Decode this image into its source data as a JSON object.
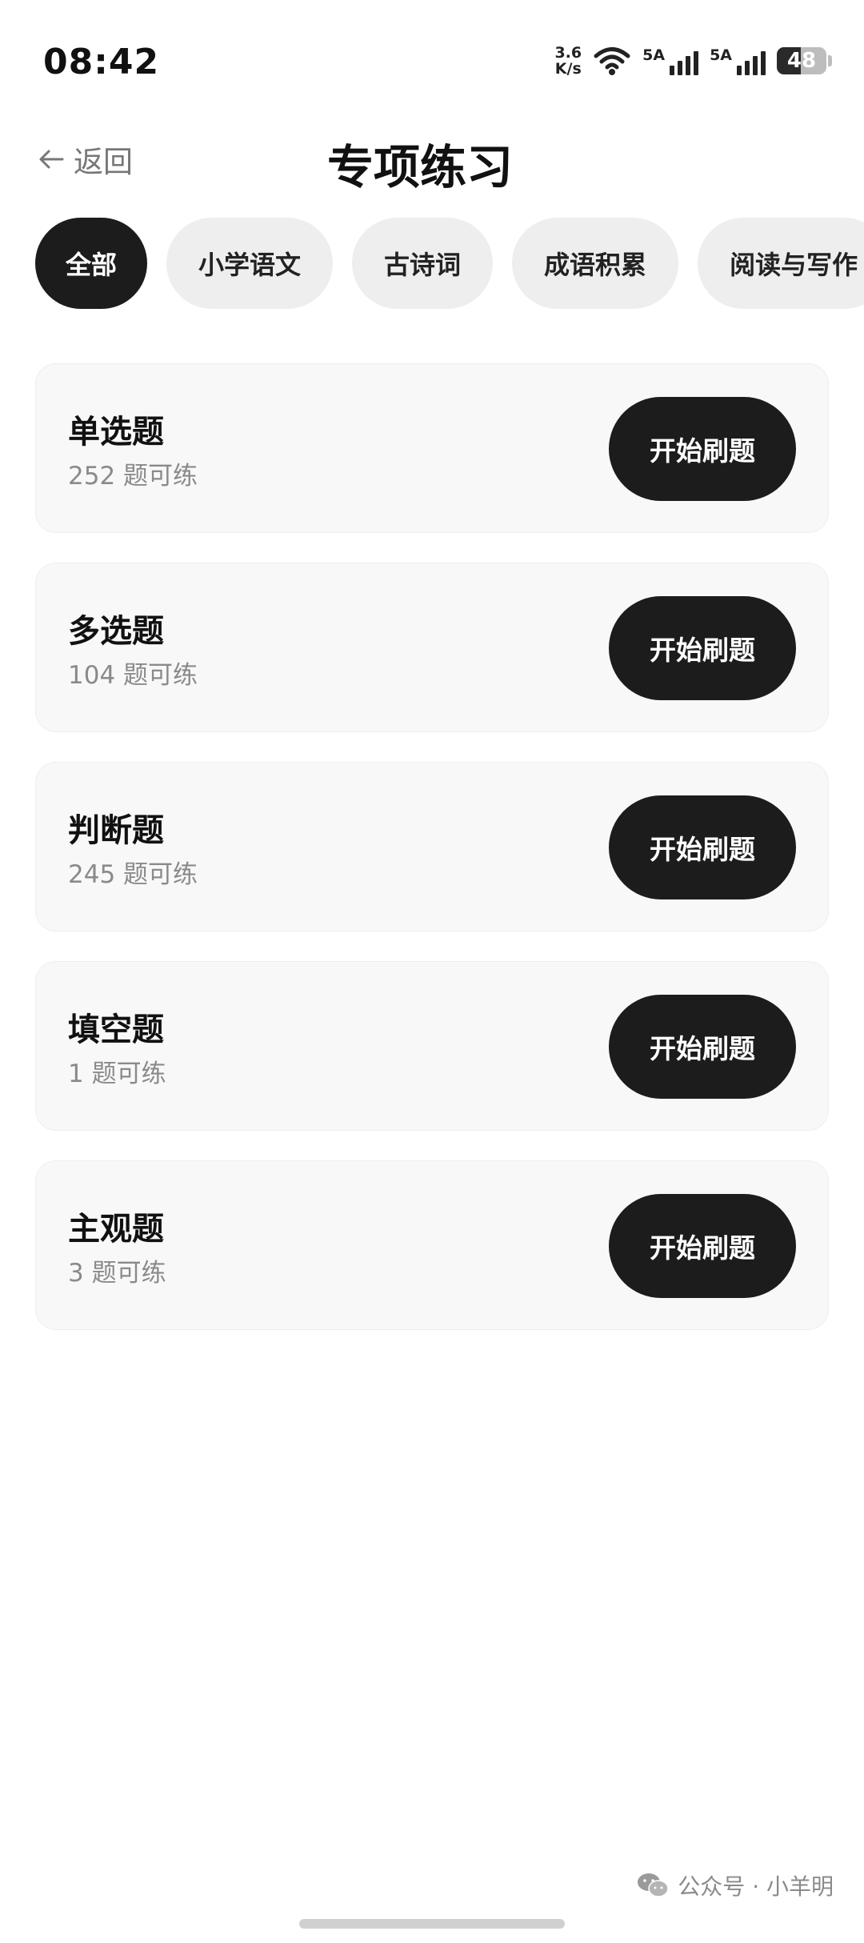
{
  "status_bar": {
    "time": "08:42",
    "net_speed_value": "3.6",
    "net_speed_unit": "K/s",
    "sim1_label": "5A",
    "sim2_label": "5A",
    "battery": "48",
    "battery_level": 0.48
  },
  "header": {
    "back_label": "返回",
    "title": "专项练习"
  },
  "tabs": [
    {
      "label": "全部",
      "active": true
    },
    {
      "label": "小学语文",
      "active": false
    },
    {
      "label": "古诗词",
      "active": false
    },
    {
      "label": "成语积累",
      "active": false
    },
    {
      "label": "阅读与写作",
      "active": false
    }
  ],
  "cards": [
    {
      "name": "单选题",
      "count": "252 题可练",
      "button": "开始刷题"
    },
    {
      "name": "多选题",
      "count": "104 题可练",
      "button": "开始刷题"
    },
    {
      "name": "判断题",
      "count": "245 题可练",
      "button": "开始刷题"
    },
    {
      "name": "填空题",
      "count": "1 题可练",
      "button": "开始刷题"
    },
    {
      "name": "主观题",
      "count": "3 题可练",
      "button": "开始刷题"
    }
  ],
  "watermark": {
    "text": "公众号 · 小羊明",
    "icon": "wechat-icon"
  }
}
